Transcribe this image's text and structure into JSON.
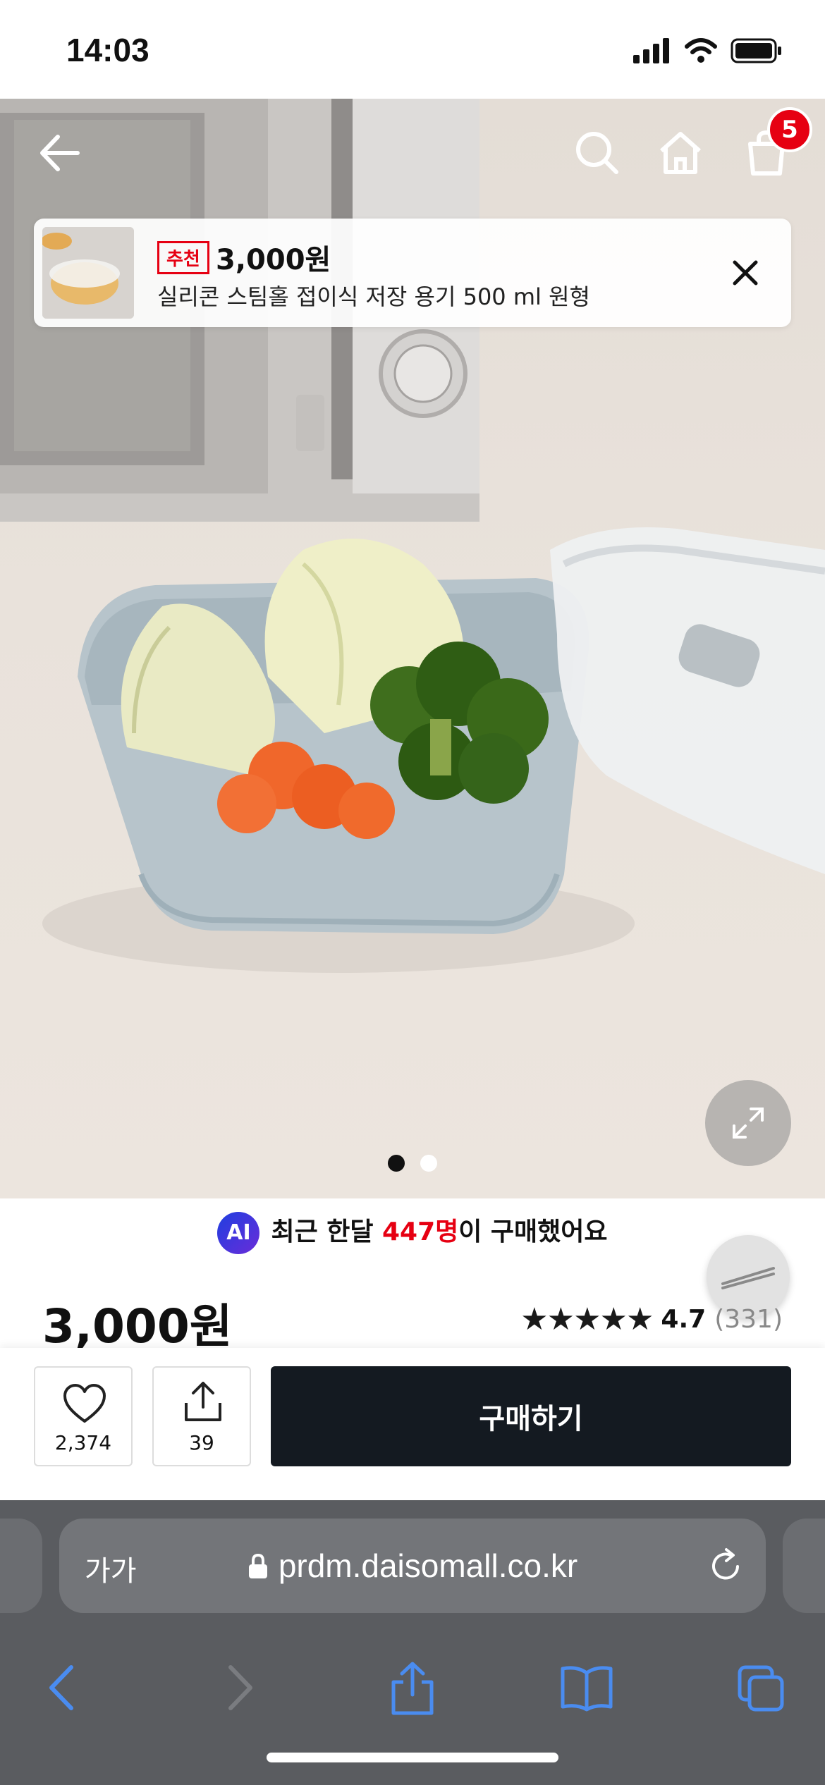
{
  "status_bar": {
    "time": "14:03"
  },
  "header": {
    "cart_count": "5"
  },
  "recommend_banner": {
    "tag": "추천",
    "price": "3,000원",
    "name": "실리콘 스팀홀 접이식 저장 용기 500 ml 원형"
  },
  "gallery": {
    "total_pages": 2,
    "current_page": 1
  },
  "ai_summary": {
    "badge": "AI",
    "prefix": "최근 한달 ",
    "highlight": "447명",
    "suffix": "이 구매했어요"
  },
  "product": {
    "price": "3,000원",
    "rating_score": "4.7",
    "rating_count": "(331)",
    "stars": "★★★★★"
  },
  "buy_bar": {
    "likes": "2,374",
    "shares": "39",
    "buy_label": "구매하기"
  },
  "browser": {
    "text_size_label": "가가",
    "url": "prdm.daisomall.co.kr"
  },
  "colors": {
    "brand_red": "#e60012",
    "buy_button": "#141a21",
    "browser_accent": "#4a8cf0"
  }
}
